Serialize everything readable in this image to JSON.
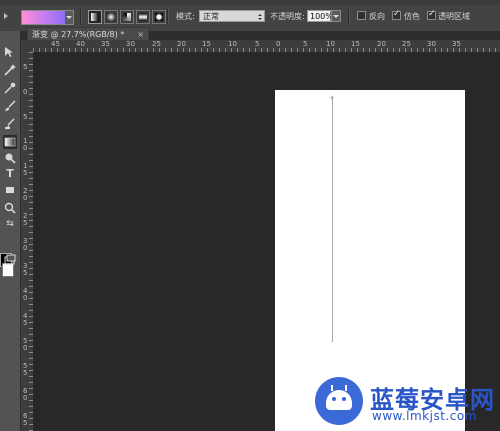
{
  "options_bar": {
    "mode_label": "模式:",
    "mode_value": "正常",
    "opacity_label": "不透明度:",
    "opacity_value": "100%",
    "reverse_label": "反向",
    "reverse_checked": false,
    "dither_label": "仿色",
    "dither_checked": true,
    "transparency_label": "透明区域",
    "transparency_checked": true,
    "gradient_colors": [
      "#ff8fd6",
      "#8c6df5"
    ]
  },
  "document_tab": {
    "title": "渐变 @ 27.7%(RGB/8) *",
    "close": "×"
  },
  "ruler": {
    "h_labels": [
      "45",
      "40",
      "35",
      "30",
      "25",
      "20",
      "15",
      "10",
      "5",
      "0",
      "5",
      "10",
      "15",
      "20",
      "25",
      "30",
      "35"
    ],
    "v_labels": [
      "5",
      "0",
      "5",
      "1\n0",
      "1\n5",
      "2\n0",
      "2\n5",
      "3\n0",
      "3\n5",
      "4\n0",
      "4\n5",
      "5\n0",
      "5\n5",
      "6\n0",
      "6\n5"
    ]
  },
  "toolbar": {
    "tools": [
      "move-tool",
      "magic-wand-tool",
      "eyedropper-tool",
      "brush-tool",
      "clone-stamp-tool",
      "gradient-tool",
      "dodge-tool",
      "type-tool",
      "rectangle-tool",
      "zoom-tool",
      "swap-colors",
      "screen-mode"
    ]
  },
  "watermark": {
    "title": "蓝莓安卓网",
    "url": "www.lmkjst.com"
  },
  "colors": {
    "workspace": "#282828",
    "panel": "#535353",
    "canvas": "#ffffff",
    "watermark_blue": "#2a55c9"
  }
}
